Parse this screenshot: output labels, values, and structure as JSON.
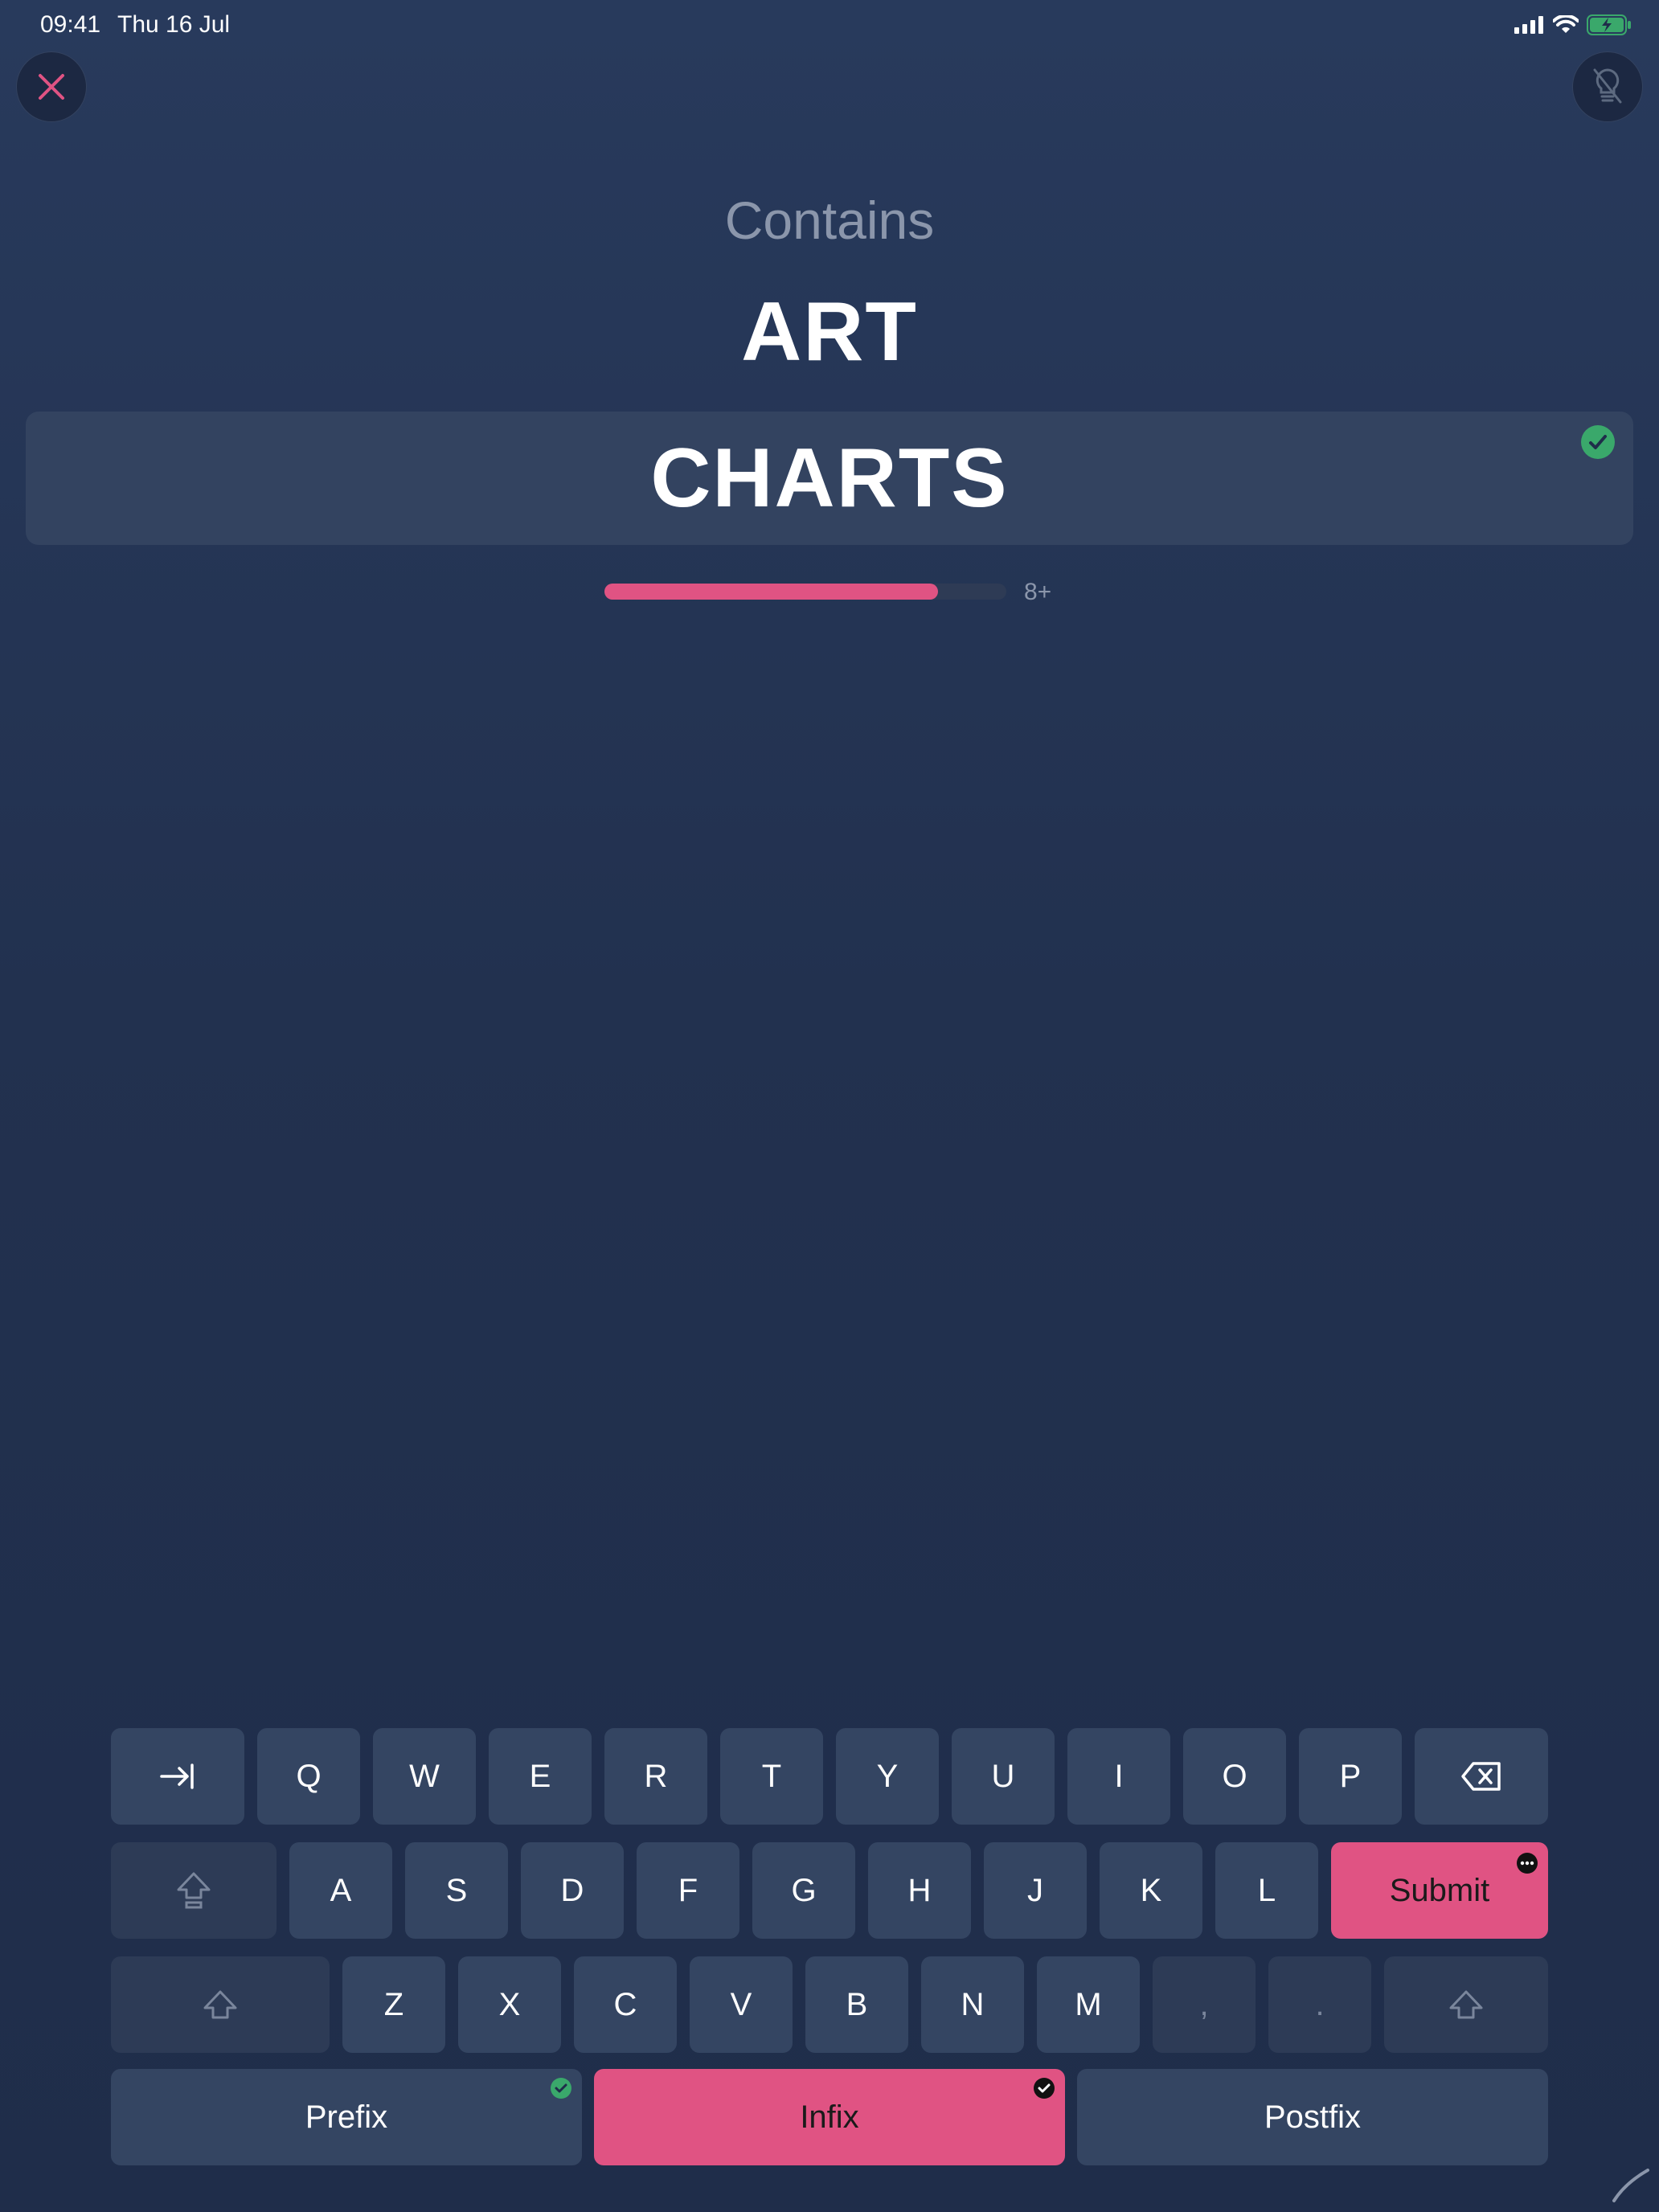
{
  "status_bar": {
    "time": "09:41",
    "date": "Thu 16 Jul"
  },
  "prompt": {
    "label": "Contains",
    "value": "ART"
  },
  "answer": {
    "text": "CHARTS"
  },
  "progress": {
    "fraction": 0.83,
    "label": "8+"
  },
  "colors": {
    "accent": "#e05383",
    "success": "#3aa86b",
    "key_bg": "#344562",
    "background": "#22314f"
  },
  "icons": {
    "close": "close-icon",
    "hint": "lightbulb-off-icon",
    "check": "check-circle-icon",
    "tab": "tab-arrow-icon",
    "backspace": "backspace-icon",
    "shift": "shift-icon",
    "more": "ellipsis-icon"
  },
  "keyboard": {
    "row1": [
      "Q",
      "W",
      "E",
      "R",
      "T",
      "Y",
      "U",
      "I",
      "O",
      "P"
    ],
    "row2": [
      "A",
      "S",
      "D",
      "F",
      "G",
      "H",
      "J",
      "K",
      "L"
    ],
    "row3": [
      "Z",
      "X",
      "C",
      "V",
      "B",
      "N",
      "M"
    ],
    "comma": ",",
    "period": ".",
    "submit": "Submit",
    "modes": [
      "Prefix",
      "Infix",
      "Postfix"
    ]
  }
}
